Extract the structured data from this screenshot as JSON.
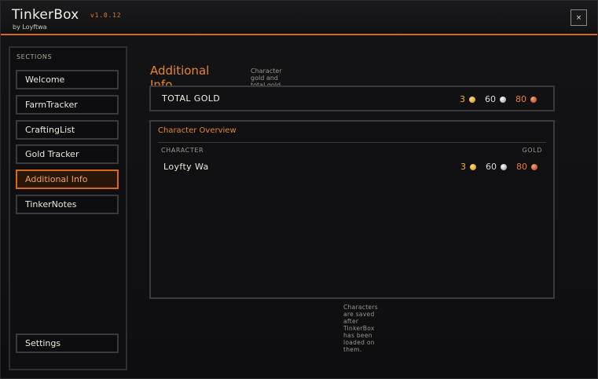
{
  "app": {
    "title": "TinkerBox",
    "version": "v1.0.12",
    "byline": "by Loyftwa",
    "close_label": "×"
  },
  "sidebar": {
    "heading": "SECTIONS",
    "items": [
      {
        "label": "Welcome",
        "active": false
      },
      {
        "label": "FarmTracker",
        "active": false
      },
      {
        "label": "CraftingList",
        "active": false
      },
      {
        "label": "Gold Tracker",
        "active": false
      },
      {
        "label": "Additional Info",
        "active": true
      },
      {
        "label": "TinkerNotes",
        "active": false
      }
    ],
    "settings_label": "Settings"
  },
  "main": {
    "title": "Additional Info",
    "subtitle": "Character gold and total gold",
    "total": {
      "label": "TOTAL GOLD",
      "gold": "3",
      "silver": "60",
      "copper": "80"
    },
    "overview": {
      "title": "Character Overview",
      "col_character": "CHARACTER",
      "col_gold": "GOLD",
      "rows": [
        {
          "name": "Loyfty Wa",
          "gold": "3",
          "silver": "60",
          "copper": "80"
        }
      ]
    },
    "footer_note": "Characters are saved after TinkerBox has been loaded on them."
  },
  "colors": {
    "accent": "#d46a1a",
    "gold": "#f2b430",
    "silver": "#d8d8d8",
    "copper": "#ec7a2e"
  }
}
